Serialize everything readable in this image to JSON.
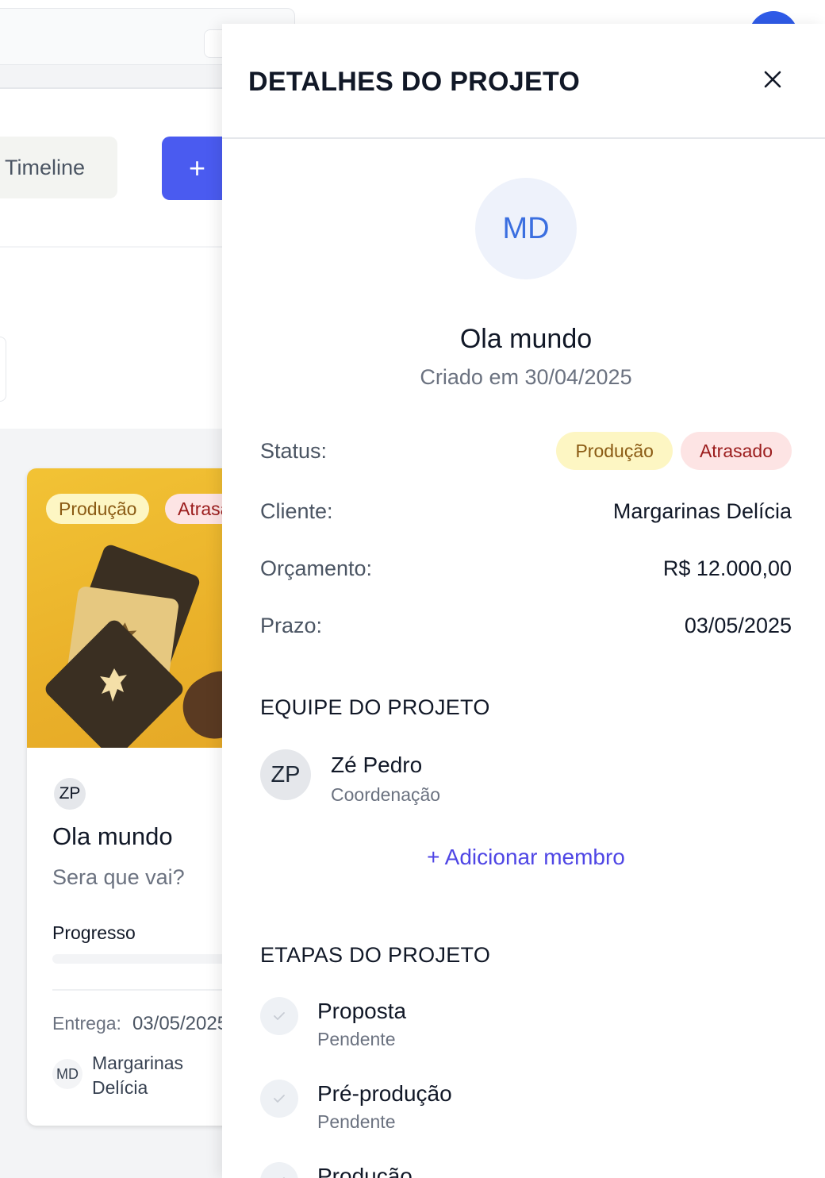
{
  "background": {
    "tab_timeline_label": "Timeline",
    "add_button_label": "+",
    "card": {
      "badges": [
        "Produção",
        "Atrasado"
      ],
      "member_initials": "ZP",
      "title": "Ola mundo",
      "description": "Sera que vai?",
      "progress_label": "Progresso",
      "progress_value": 0,
      "delivery_label": "Entrega:",
      "delivery_value": "03/05/2025",
      "client_initials": "MD",
      "client_name": "Margarinas Delícia"
    }
  },
  "drawer": {
    "title": "DETALHES DO PROJETO",
    "close_icon": "close-icon",
    "avatar_initials": "MD",
    "project_name": "Ola mundo",
    "created_text": "Criado em 30/04/2025",
    "status_label": "Status:",
    "status_badges": [
      "Produção",
      "Atrasado"
    ],
    "client_label": "Cliente:",
    "client_value": "Margarinas Delícia",
    "budget_label": "Orçamento:",
    "budget_value": "R$ 12.000,00",
    "deadline_label": "Prazo:",
    "deadline_value": "03/05/2025",
    "team_title": "EQUIPE DO PROJETO",
    "team": [
      {
        "initials": "ZP",
        "name": "Zé Pedro",
        "role": "Coordenação"
      }
    ],
    "add_member_label": "+ Adicionar membro",
    "stages_title": "ETAPAS DO PROJETO",
    "stages": [
      {
        "name": "Proposta",
        "status": "Pendente"
      },
      {
        "name": "Pré-produção",
        "status": "Pendente"
      },
      {
        "name": "Produção",
        "status": ""
      }
    ]
  },
  "colors": {
    "accent": "#4a5bf0",
    "link": "#4f46e5",
    "badge_production_bg": "#fdf6c3",
    "badge_production_text": "#8a5a13",
    "badge_late_bg": "#fde4e4",
    "badge_late_text": "#9b1c1c"
  }
}
